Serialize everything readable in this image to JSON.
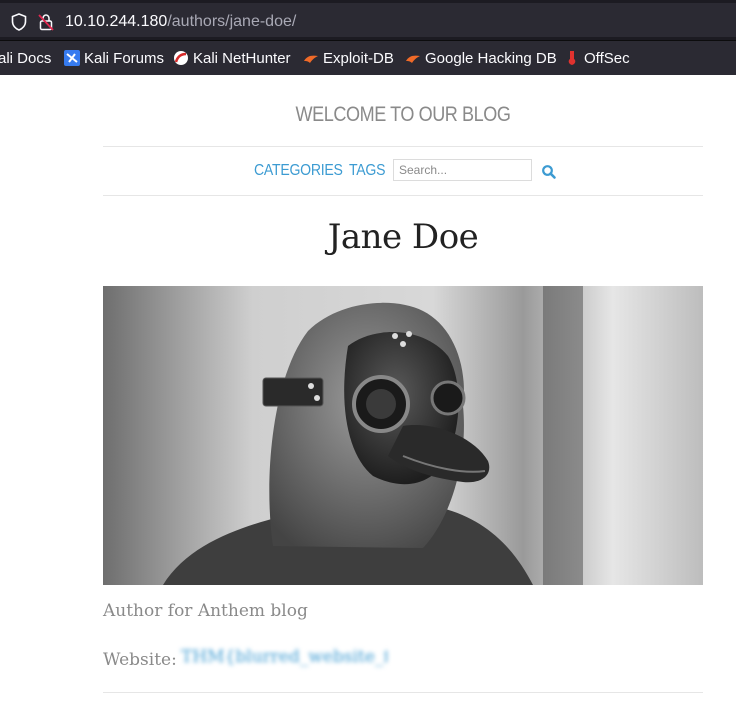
{
  "browser": {
    "url_host": "10.10.244.180",
    "url_path": "/authors/jane-doe/",
    "bookmarks": [
      {
        "label": "ali Docs",
        "icon": "kali-docs-icon"
      },
      {
        "label": "Kali Forums",
        "icon": "kali-forums-icon"
      },
      {
        "label": "Kali NetHunter",
        "icon": "kali-nethunter-icon"
      },
      {
        "label": "Exploit-DB",
        "icon": "exploit-db-icon"
      },
      {
        "label": "Google Hacking DB",
        "icon": "google-hacking-db-icon"
      },
      {
        "label": "OffSec",
        "icon": "offsec-icon"
      }
    ]
  },
  "blog": {
    "title": "WELCOME TO OUR BLOG",
    "nav": {
      "categories": "CATEGORIES",
      "tags": "TAGS"
    },
    "search": {
      "placeholder": "Search..."
    }
  },
  "author": {
    "name": "Jane Doe",
    "photo_alt": "plague-doctor-mask-photo",
    "bio": "Author for Anthem blog",
    "website_label": "Website:",
    "website_value": "THM{blurred_website_flag}"
  },
  "colors": {
    "link": "#3c9bd2",
    "muted_text": "#8a8a8a",
    "chrome_bg": "#2b2a33"
  }
}
